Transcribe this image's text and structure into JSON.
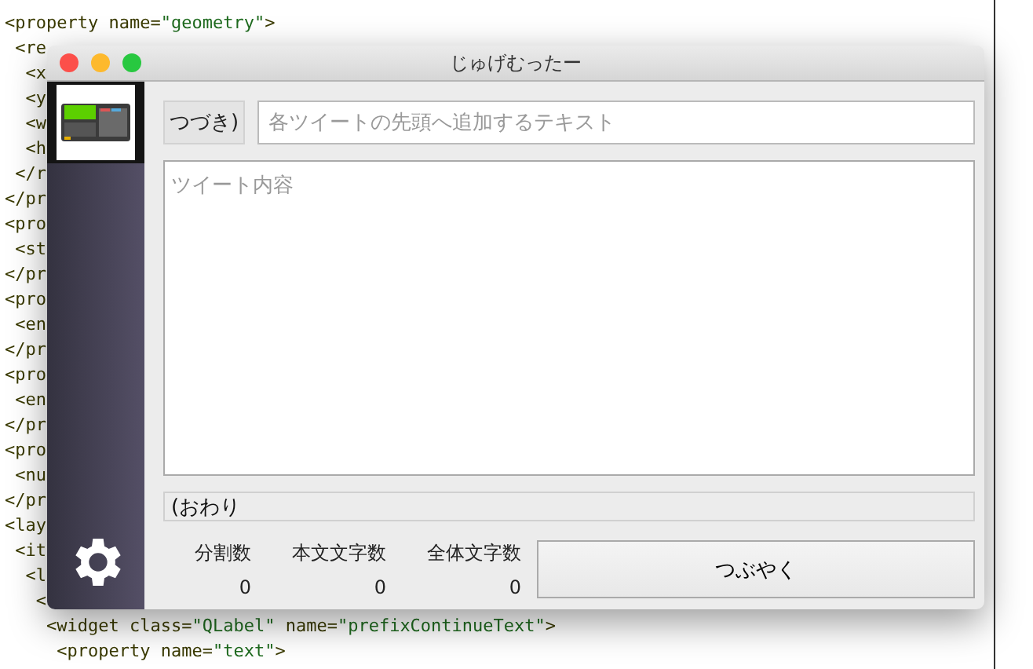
{
  "editor": {
    "lines": [
      [
        {
          "text": "<property name=",
          "kind": "tag"
        },
        {
          "text": "\"geometry\"",
          "kind": "value"
        },
        {
          "text": ">",
          "kind": "tag"
        }
      ],
      [
        {
          "text": " <re",
          "kind": "tag"
        }
      ],
      [
        {
          "text": "  <x",
          "kind": "tag"
        }
      ],
      [
        {
          "text": "  <y",
          "kind": "tag"
        }
      ],
      [
        {
          "text": "  <w",
          "kind": "tag"
        }
      ],
      [
        {
          "text": "  <h",
          "kind": "tag"
        }
      ],
      [
        {
          "text": " </r",
          "kind": "tag"
        }
      ],
      [
        {
          "text": "</pr",
          "kind": "tag"
        }
      ],
      [
        {
          "text": "<pro",
          "kind": "tag"
        }
      ],
      [
        {
          "text": " <st",
          "kind": "tag"
        }
      ],
      [
        {
          "text": "</pr",
          "kind": "tag"
        }
      ],
      [
        {
          "text": "<pro",
          "kind": "tag"
        }
      ],
      [
        {
          "text": " <en",
          "kind": "tag"
        }
      ],
      [
        {
          "text": "</pr",
          "kind": "tag"
        }
      ],
      [
        {
          "text": "<pro",
          "kind": "tag"
        }
      ],
      [
        {
          "text": " <en",
          "kind": "tag"
        }
      ],
      [
        {
          "text": "</pr",
          "kind": "tag"
        }
      ],
      [
        {
          "text": "<pro",
          "kind": "tag"
        }
      ],
      [
        {
          "text": " <nu",
          "kind": "tag"
        }
      ],
      [
        {
          "text": "</pr",
          "kind": "tag"
        }
      ],
      [
        {
          "text": "<lay",
          "kind": "tag"
        }
      ],
      [
        {
          "text": " <it",
          "kind": "tag"
        }
      ],
      [
        {
          "text": "  <l",
          "kind": "tag"
        }
      ],
      [
        {
          "text": "   <",
          "kind": "tag"
        }
      ],
      [
        {
          "text": "    <widget class=",
          "kind": "tag"
        },
        {
          "text": "\"QLabel\"",
          "kind": "value"
        },
        {
          "text": " name=",
          "kind": "tag"
        },
        {
          "text": "\"prefixContinueText\"",
          "kind": "value"
        },
        {
          "text": ">",
          "kind": "tag"
        }
      ],
      [
        {
          "text": "     <property name=",
          "kind": "tag"
        },
        {
          "text": "\"text\"",
          "kind": "value"
        },
        {
          "text": ">",
          "kind": "tag"
        }
      ]
    ]
  },
  "window": {
    "title": "じゅげむったー"
  },
  "continue_button": "つづき)",
  "prefix_field": {
    "placeholder": "各ツイートの先頭へ追加するテキスト"
  },
  "tweet_field": {
    "placeholder": "ツイート内容"
  },
  "suffix_field": {
    "value": "(おわり"
  },
  "stats": [
    {
      "label": "分割数",
      "value": "0"
    },
    {
      "label": "本文文字数",
      "value": "0"
    },
    {
      "label": "全体文字数",
      "value": "0"
    }
  ],
  "tweet_button": "つぶやく"
}
